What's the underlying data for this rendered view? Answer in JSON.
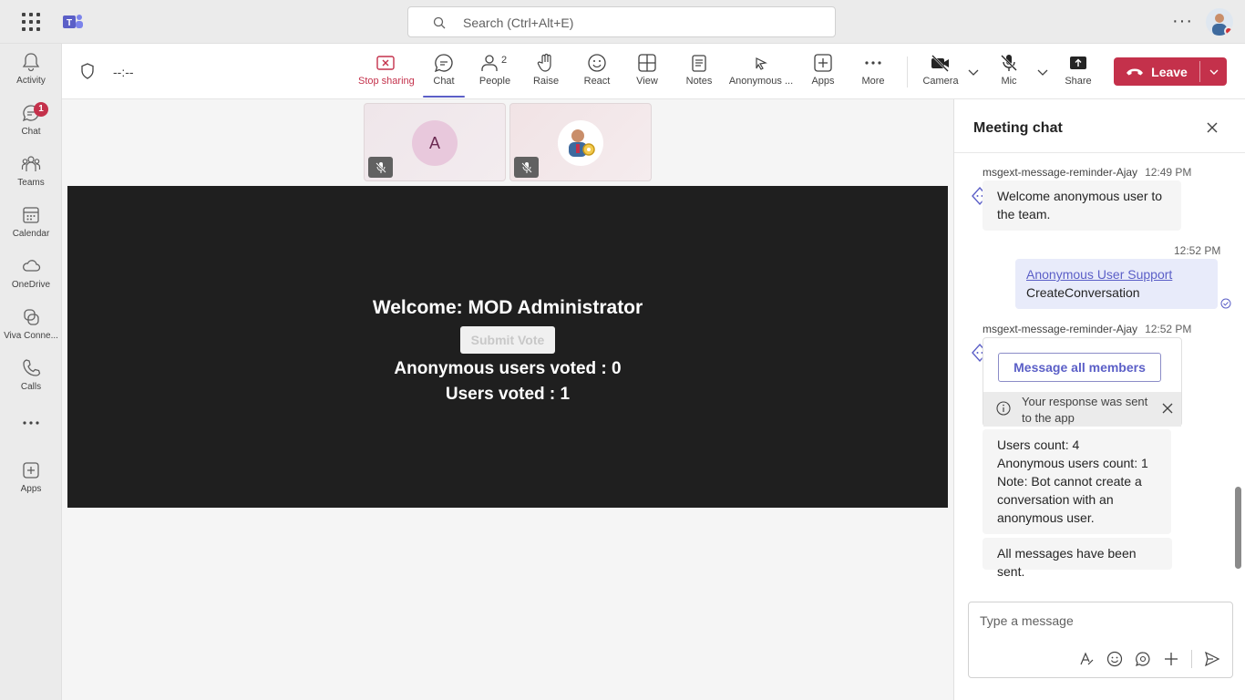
{
  "app": {
    "search_placeholder": "Search (Ctrl+Alt+E)"
  },
  "rail": {
    "items": [
      {
        "label": "Activity",
        "icon": "bell-icon"
      },
      {
        "label": "Chat",
        "icon": "chat-icon",
        "badge": "1"
      },
      {
        "label": "Teams",
        "icon": "teams-icon"
      },
      {
        "label": "Calendar",
        "icon": "calendar-icon"
      },
      {
        "label": "OneDrive",
        "icon": "cloud-icon"
      },
      {
        "label": "Viva Conne...",
        "icon": "viva-icon"
      },
      {
        "label": "Calls",
        "icon": "phone-icon"
      },
      {
        "label": "",
        "icon": "more-icon"
      },
      {
        "label": "Apps",
        "icon": "add-apps-icon"
      }
    ]
  },
  "meeting": {
    "timer": "--:--",
    "toolbar": {
      "stop_sharing": "Stop sharing",
      "chat": "Chat",
      "people": "People",
      "people_count": "2",
      "raise": "Raise",
      "react": "React",
      "view": "View",
      "notes": "Notes",
      "anonymous": "Anonymous ...",
      "apps": "Apps",
      "more": "More",
      "camera": "Camera",
      "mic": "Mic",
      "share": "Share",
      "leave": "Leave"
    },
    "tiles": [
      {
        "initial": "A",
        "muted": true
      },
      {
        "initial": "",
        "muted": true
      }
    ],
    "shared_content": {
      "welcome": "Welcome: MOD Administrator",
      "submit_vote": "Submit Vote",
      "anonymous_voted": "Anonymous users voted : 0",
      "users_voted": "Users voted : 1"
    }
  },
  "chat": {
    "title": "Meeting chat",
    "messages": [
      {
        "sender": "msgext-message-reminder-Ajay",
        "time": "12:49 PM",
        "text": "Welcome anonymous user to the team."
      },
      {
        "time": "12:52 PM",
        "link": "Anonymous User Support",
        "text": "CreateConversation"
      },
      {
        "sender": "msgext-message-reminder-Ajay",
        "time": "12:52 PM",
        "card_button": "Message all members",
        "card_notice": "Your response was sent to the app",
        "line1": "Users count: 4",
        "line2": "Anonymous users count: 1",
        "line3": "Note: Bot cannot create a conversation with an anonymous user.",
        "final": "All messages have been sent."
      }
    ],
    "compose_placeholder": "Type a message"
  },
  "colors": {
    "accent": "#5b5fc7",
    "leave": "#c4314b",
    "stage": "#1f1f1f"
  }
}
